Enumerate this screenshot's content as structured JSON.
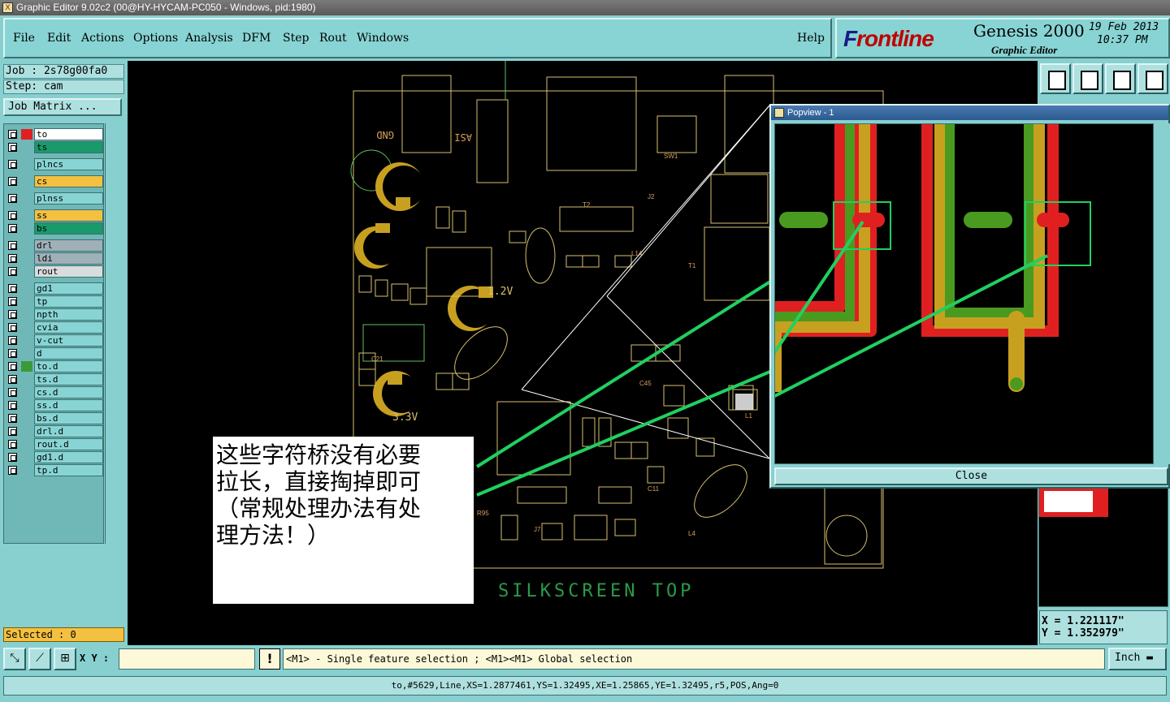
{
  "window": {
    "title": "Graphic Editor 9.02c2 (00@HY-HYCAM-PC050 - Windows, pid:1980)"
  },
  "menu": {
    "items": [
      "File",
      "Edit",
      "Actions",
      "Options",
      "Analysis",
      "DFM",
      "Step",
      "Rout",
      "Windows"
    ],
    "help": "Help"
  },
  "branding": {
    "brand_prefix": "F",
    "brand_rest": "rontline",
    "product": "Genesis 2000",
    "subtitle": "Graphic Editor",
    "date": "19 Feb 2013",
    "time": "10:37 PM"
  },
  "job": {
    "job_label": "Job : 2s78g00fa0",
    "step_label": "Step: cam",
    "matrix_button": "Job Matrix ..."
  },
  "layers": [
    {
      "name": "to",
      "color": "#ffffff",
      "swatch": "#e02020"
    },
    {
      "name": "ts",
      "color": "#1a9a6a",
      "swatch": "#70b8b8"
    },
    {
      "name": "plncs",
      "color": "#88d4d4",
      "swatch": "#70b8b8"
    },
    {
      "name": "cs",
      "color": "#f4c040",
      "swatch": "#70b8b8"
    },
    {
      "name": "plnss",
      "color": "#88d4d4",
      "swatch": "#70b8b8"
    },
    {
      "name": "ss",
      "color": "#f4c040",
      "swatch": "#70b8b8"
    },
    {
      "name": "bs",
      "color": "#1a9a6a",
      "swatch": "#70b8b8"
    },
    {
      "name": "drl",
      "color": "#a0b0b8",
      "swatch": "#70b8b8"
    },
    {
      "name": "ldi",
      "color": "#a0b0b8",
      "swatch": "#70b8b8"
    },
    {
      "name": "rout",
      "color": "#d8dcdc",
      "swatch": "#70b8b8"
    },
    {
      "name": "gd1",
      "color": "#88d4d4",
      "swatch": "#70b8b8"
    },
    {
      "name": "tp",
      "color": "#88d4d4",
      "swatch": "#70b8b8"
    },
    {
      "name": "npth",
      "color": "#88d4d4",
      "swatch": "#70b8b8"
    },
    {
      "name": "cvia",
      "color": "#88d4d4",
      "swatch": "#70b8b8"
    },
    {
      "name": "v-cut",
      "color": "#88d4d4",
      "swatch": "#70b8b8"
    },
    {
      "name": "d",
      "color": "#88d4d4",
      "swatch": "#70b8b8"
    },
    {
      "name": "to.d",
      "color": "#88d4d4",
      "swatch": "#3a9a3a"
    },
    {
      "name": "ts.d",
      "color": "#88d4d4",
      "swatch": "#70b8b8"
    },
    {
      "name": "cs.d",
      "color": "#88d4d4",
      "swatch": "#70b8b8"
    },
    {
      "name": "ss.d",
      "color": "#88d4d4",
      "swatch": "#70b8b8"
    },
    {
      "name": "bs.d",
      "color": "#88d4d4",
      "swatch": "#70b8b8"
    },
    {
      "name": "drl.d",
      "color": "#88d4d4",
      "swatch": "#70b8b8"
    },
    {
      "name": "rout.d",
      "color": "#88d4d4",
      "swatch": "#70b8b8"
    },
    {
      "name": "gd1.d",
      "color": "#88d4d4",
      "swatch": "#70b8b8"
    },
    {
      "name": "tp.d",
      "color": "#88d4d4",
      "swatch": "#70b8b8"
    }
  ],
  "selected": "Selected : 0",
  "canvas": {
    "silkscreen_label": "SILKSCREEN TOP",
    "board_labels": [
      "GND",
      "ASI",
      "1.2V",
      "3.3V"
    ]
  },
  "popview": {
    "title": "Popview - 1",
    "close_label": "Close"
  },
  "annotation": {
    "text_line1": "这些字符桥没有必要",
    "text_line2": "拉长，直接掏掉即可",
    "text_line3": "（常规处理办法有处",
    "text_line4": "理方法！）"
  },
  "coords": {
    "x": "X = 1.221117\"",
    "y": "Y = 1.352979\""
  },
  "command": {
    "xy_label": "X Y :",
    "xy_value": "",
    "warn_icon": "!",
    "message": "<M1> - Single feature selection ; <M1><M1> Global selection",
    "unit": "Inch"
  },
  "status": {
    "text": "to,#5629,Line,XS=1.2877461,YS=1.32495,XE=1.25865,YE=1.32495,r5,POS,Ang=0"
  }
}
